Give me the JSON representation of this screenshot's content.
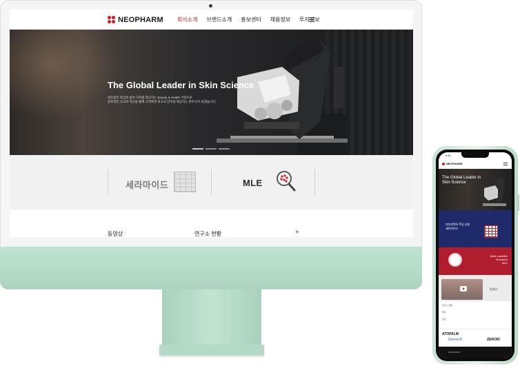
{
  "desktop": {
    "logo": "NEOPHARM",
    "nav": [
      "회사소개",
      "브랜드소개",
      "홍보센터",
      "채용정보",
      "투자정보"
    ],
    "hero": {
      "title": "The Global Leader in Skin Science",
      "desc_line1": "네오팜은 최상의 삶의 가치를 제공하는 Beauty & Health 기업으로",
      "desc_line2": "창조적인 사고와 혁신을 통해 고객에게 최고의 만족을 제공하는 파트너가 되겠습니다."
    },
    "brands": {
      "first": "세라마이드",
      "second": "MLE"
    },
    "lower": {
      "left": "동영상",
      "middle": "연구소 현황",
      "plus": "+"
    }
  },
  "phone": {
    "status_time": "9:41",
    "logo": "NEOPHARM",
    "hero_title": "The Global Leader in Skin Science",
    "blue_text_1": "피부장벽의 핵심 성분",
    "blue_text_2": "세라마이드",
    "red_text_1": "Multi-Lamellar",
    "red_text_2": "Emulsion",
    "red_text_3": "MLE",
    "video_label": "동영상",
    "table_row_1": "연구소 현황",
    "table_row_2": "특허",
    "table_row_3": "논문",
    "brand_1": "ATOPALM",
    "brand_2": "Derma:B",
    "brand_3": "ZEROID",
    "footer": "NEOPHARM"
  },
  "colors": {
    "brand_red": "#d7191f",
    "imac_green": "#b7dcc9",
    "phone_blue": "#1f2a6b",
    "phone_red": "#b01e2e"
  }
}
